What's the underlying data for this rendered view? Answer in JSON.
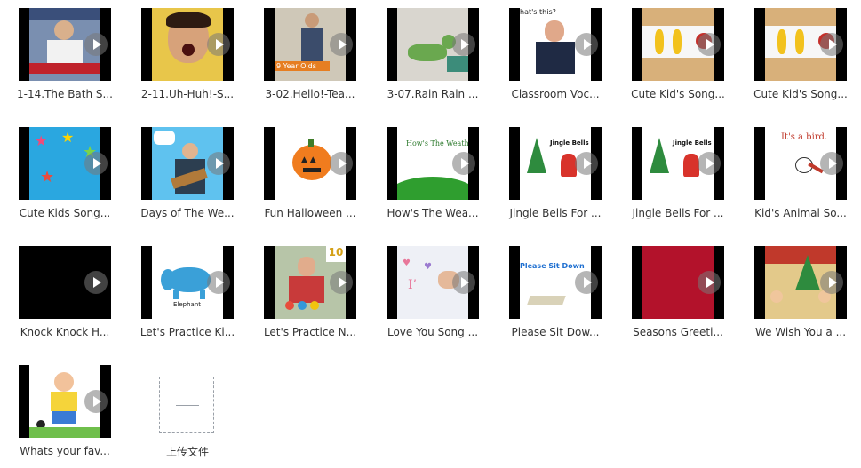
{
  "files": [
    {
      "title": "1-14.The Bath S..."
    },
    {
      "title": "2-11.Uh-Huh!-S..."
    },
    {
      "title": "3-02.Hello!-Tea...",
      "overlay": "9 Year Olds"
    },
    {
      "title": "3-07.Rain Rain ..."
    },
    {
      "title": "Classroom Voc...",
      "overlay": "hat's this?"
    },
    {
      "title": "Cute Kid's Song..."
    },
    {
      "title": "Cute Kid's Song..."
    },
    {
      "title": "Cute Kids Song..."
    },
    {
      "title": "Days of The We..."
    },
    {
      "title": "Fun Halloween ..."
    },
    {
      "title": "How's The Wea...",
      "overlay": "How's The Weath"
    },
    {
      "title": "Jingle Bells For ...",
      "overlay": "Jingle Bells"
    },
    {
      "title": "Jingle Bells For ...",
      "overlay": "Jingle Bells"
    },
    {
      "title": "Kid's Animal So...",
      "overlay": "It's a bird."
    },
    {
      "title": "Knock Knock H..."
    },
    {
      "title": "Let's Practice Ki...",
      "overlay": "Elephant"
    },
    {
      "title": "Let's Practice N...",
      "overlay": "10"
    },
    {
      "title": "Love You Song ..."
    },
    {
      "title": "Please Sit Dow...",
      "overlay": "Please Sit Down"
    },
    {
      "title": "Seasons Greeti..."
    },
    {
      "title": "We Wish You a ..."
    },
    {
      "title": "Whats your fav..."
    }
  ],
  "upload": {
    "label": "上传文件"
  },
  "colors": {
    "caption": "#333333",
    "tile_bg": "#000000",
    "play": "#ffffff"
  }
}
